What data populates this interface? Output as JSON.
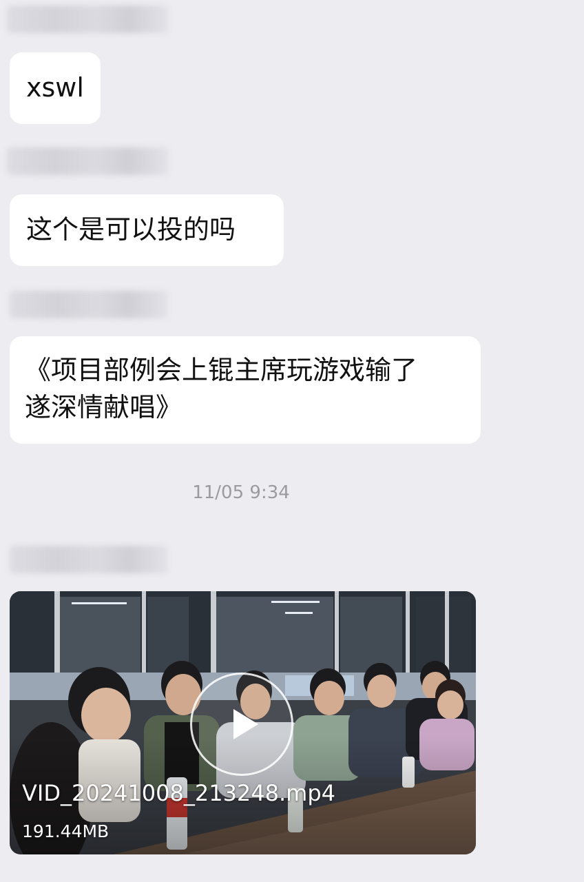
{
  "messages": [
    {
      "text": "xswl"
    },
    {
      "text": "这个是可以投的吗"
    },
    {
      "text": "《项目部例会上锟主席玩游戏输了\n遂深情献唱》"
    }
  ],
  "timestamp": "11/05 9:34",
  "video": {
    "filename": "VID_20241008_213248.mp4",
    "size": "191.44MB"
  },
  "colors": {
    "background": "#ececf1",
    "bubble": "#ffffff",
    "timestamp_text": "#9a9aa0"
  },
  "icons": [
    "play-icon"
  ]
}
